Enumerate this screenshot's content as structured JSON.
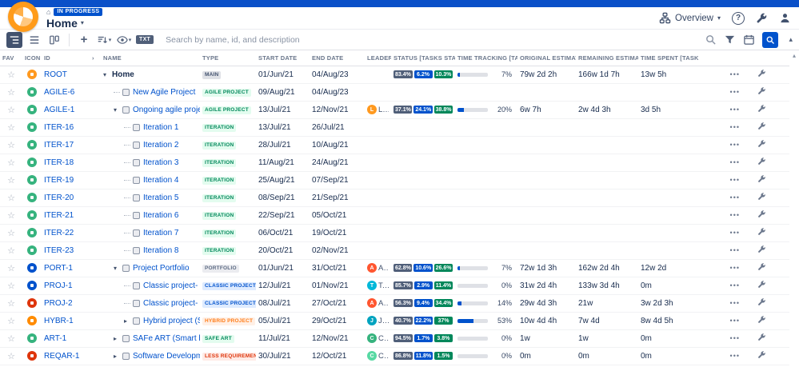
{
  "header": {
    "status_badge": "IN PROGRESS",
    "title": "Home",
    "overview_label": "Overview",
    "help_label": "?"
  },
  "toolbar": {
    "add_label": "+",
    "txt_label": "TXT",
    "search_placeholder": "Search by name, id, and description"
  },
  "icons": {
    "house": "⌂",
    "chevron_down": "▾",
    "chevron_right": "▸",
    "chevron_up": "▴",
    "star": "☆",
    "more": "•••"
  },
  "colors": {
    "accent": "#0052cc",
    "topstrip": "#0a50c8",
    "status_colors": [
      "#505f79",
      "#0052cc",
      "#00875a"
    ],
    "type_styles": {
      "main": {
        "bg": "#dfe1e6",
        "fg": "#42526e"
      },
      "agile": {
        "bg": "#e3fcef",
        "fg": "#00875a"
      },
      "iteration": {
        "bg": "#e3fcef",
        "fg": "#00875a"
      },
      "portfolio": {
        "bg": "#ebecf0",
        "fg": "#5e6c84"
      },
      "classic": {
        "bg": "#deebff",
        "fg": "#0052cc"
      },
      "hybrid": {
        "bg": "#fff0e6",
        "fg": "#ff7d1a"
      },
      "safe": {
        "bg": "#e3fcef",
        "fg": "#00875a"
      },
      "less": {
        "bg": "#ffebe6",
        "fg": "#de350b"
      }
    }
  },
  "table": {
    "columns": [
      {
        "key": "fav",
        "label": "FAV"
      },
      {
        "key": "icon",
        "label": "ICON"
      },
      {
        "key": "id",
        "label": "ID"
      },
      {
        "key": "chev",
        "label": "›"
      },
      {
        "key": "name",
        "label": "NAME"
      },
      {
        "key": "type",
        "label": "TYPE"
      },
      {
        "key": "start",
        "label": "START DATE"
      },
      {
        "key": "end",
        "label": "END DATE"
      },
      {
        "key": "leader",
        "label": "LEADER"
      },
      {
        "key": "status",
        "label": "STATUS [TASKS STATUS ("
      },
      {
        "key": "tracking",
        "label": "TIME TRACKING [TASKS S"
      },
      {
        "key": "original",
        "label": "ORIGINAL ESTIMATE ["
      },
      {
        "key": "remaining",
        "label": "REMAINING ESTIMATI"
      },
      {
        "key": "spent",
        "label": "TIME SPENT [TASKS S"
      },
      {
        "key": "actions",
        "label": ""
      }
    ],
    "rows": [
      {
        "id": "ROOT",
        "icon_color": "#ff991f",
        "level": 0,
        "expander": "down",
        "box": false,
        "name": "Home",
        "link": false,
        "type": "MAIN",
        "type_key": "main",
        "start": "01/Jun/21",
        "end": "04/Aug/23",
        "leader": null,
        "status": [
          "83.4%",
          "6.2%",
          "10.3%"
        ],
        "tracking": {
          "label": "7%",
          "fill": 7
        },
        "original": "79w 2d 2h",
        "remaining": "166w 1d 7h",
        "spent": "13w 5h"
      },
      {
        "id": "AGILE-6",
        "icon_color": "#36b37e",
        "level": 1,
        "expander": null,
        "box": true,
        "name": "New Agile Project",
        "link": true,
        "type": "AGILE PROJECT",
        "type_key": "agile",
        "start": "09/Aug/21",
        "end": "04/Aug/23",
        "leader": null,
        "status": null,
        "tracking": null,
        "original": "",
        "remaining": "",
        "spent": ""
      },
      {
        "id": "AGILE-1",
        "icon_color": "#36b37e",
        "level": 1,
        "expander": "down",
        "box": true,
        "name": "Ongoing agile project (E-commerc",
        "link": true,
        "type": "AGILE PROJECT",
        "type_key": "agile",
        "start": "13/Jul/21",
        "end": "12/Nov/21",
        "leader": {
          "name": "Lesly",
          "color": "#ff991f"
        },
        "status": [
          "37.1%",
          "24.1%",
          "38.8%"
        ],
        "tracking": {
          "label": "20%",
          "fill": 20
        },
        "original": "6w 7h",
        "remaining": "2w 4d 3h",
        "spent": "3d 5h"
      },
      {
        "id": "ITER-16",
        "icon_color": "#36b37e",
        "level": 2,
        "expander": null,
        "box": true,
        "name": "Iteration 1",
        "link": true,
        "type": "ITERATION",
        "type_key": "iteration",
        "start": "13/Jul/21",
        "end": "26/Jul/21",
        "leader": null,
        "status": null,
        "tracking": null,
        "original": "",
        "remaining": "",
        "spent": ""
      },
      {
        "id": "ITER-17",
        "icon_color": "#36b37e",
        "level": 2,
        "expander": null,
        "box": true,
        "name": "Iteration 2",
        "link": true,
        "type": "ITERATION",
        "type_key": "iteration",
        "start": "28/Jul/21",
        "end": "10/Aug/21",
        "leader": null,
        "status": null,
        "tracking": null,
        "original": "",
        "remaining": "",
        "spent": ""
      },
      {
        "id": "ITER-18",
        "icon_color": "#36b37e",
        "level": 2,
        "expander": null,
        "box": true,
        "name": "Iteration 3",
        "link": true,
        "type": "ITERATION",
        "type_key": "iteration",
        "start": "11/Aug/21",
        "end": "24/Aug/21",
        "leader": null,
        "status": null,
        "tracking": null,
        "original": "",
        "remaining": "",
        "spent": ""
      },
      {
        "id": "ITER-19",
        "icon_color": "#36b37e",
        "level": 2,
        "expander": null,
        "box": true,
        "name": "Iteration 4",
        "link": true,
        "type": "ITERATION",
        "type_key": "iteration",
        "start": "25/Aug/21",
        "end": "07/Sep/21",
        "leader": null,
        "status": null,
        "tracking": null,
        "original": "",
        "remaining": "",
        "spent": ""
      },
      {
        "id": "ITER-20",
        "icon_color": "#36b37e",
        "level": 2,
        "expander": null,
        "box": true,
        "name": "Iteration 5",
        "link": true,
        "type": "ITERATION",
        "type_key": "iteration",
        "start": "08/Sep/21",
        "end": "21/Sep/21",
        "leader": null,
        "status": null,
        "tracking": null,
        "original": "",
        "remaining": "",
        "spent": ""
      },
      {
        "id": "ITER-21",
        "icon_color": "#36b37e",
        "level": 2,
        "expander": null,
        "box": true,
        "name": "Iteration 6",
        "link": true,
        "type": "ITERATION",
        "type_key": "iteration",
        "start": "22/Sep/21",
        "end": "05/Oct/21",
        "leader": null,
        "status": null,
        "tracking": null,
        "original": "",
        "remaining": "",
        "spent": ""
      },
      {
        "id": "ITER-22",
        "icon_color": "#36b37e",
        "level": 2,
        "expander": null,
        "box": true,
        "name": "Iteration 7",
        "link": true,
        "type": "ITERATION",
        "type_key": "iteration",
        "start": "06/Oct/21",
        "end": "19/Oct/21",
        "leader": null,
        "status": null,
        "tracking": null,
        "original": "",
        "remaining": "",
        "spent": ""
      },
      {
        "id": "ITER-23",
        "icon_color": "#36b37e",
        "level": 2,
        "expander": null,
        "box": true,
        "name": "Iteration 8",
        "link": true,
        "type": "ITERATION",
        "type_key": "iteration",
        "start": "20/Oct/21",
        "end": "02/Nov/21",
        "leader": null,
        "status": null,
        "tracking": null,
        "original": "",
        "remaining": "",
        "spent": ""
      },
      {
        "id": "PORT-1",
        "icon_color": "#0052cc",
        "level": 1,
        "expander": "down",
        "box": true,
        "name": "Project Portfolio",
        "link": true,
        "type": "PORTFOLIO",
        "type_key": "portfolio",
        "start": "01/Jun/21",
        "end": "31/Oct/21",
        "leader": {
          "name": "Ange",
          "color": "#ff5630"
        },
        "status": [
          "62.8%",
          "10.6%",
          "26.6%"
        ],
        "tracking": {
          "label": "7%",
          "fill": 7
        },
        "original": "72w 1d 3h",
        "remaining": "162w 2d 4h",
        "spent": "12w 2d"
      },
      {
        "id": "PROJ-1",
        "icon_color": "#0052cc",
        "level": 2,
        "expander": null,
        "box": true,
        "name": "Classic project- initiation (Build",
        "link": true,
        "type": "CLASSIC PROJECT",
        "type_key": "classic",
        "start": "12/Jul/21",
        "end": "01/Nov/21",
        "leader": {
          "name": "Tash",
          "color": "#00b8d9"
        },
        "status": [
          "85.7%",
          "2.9%",
          "11.4%"
        ],
        "tracking": {
          "label": "0%",
          "fill": 0
        },
        "original": "31w 2d 4h",
        "remaining": "133w 3d 4h",
        "spent": "0m"
      },
      {
        "id": "PROJ-2",
        "icon_color": "#de350b",
        "level": 2,
        "expander": null,
        "box": true,
        "name": "Classic project- progress monit",
        "link": true,
        "type": "CLASSIC PROJECT",
        "type_key": "classic",
        "start": "08/Jul/21",
        "end": "27/Oct/21",
        "leader": {
          "name": "Ange",
          "color": "#ff5630"
        },
        "status": [
          "56.3%",
          "9.4%",
          "34.4%"
        ],
        "tracking": {
          "label": "14%",
          "fill": 14
        },
        "original": "29w 4d 3h",
        "remaining": "21w",
        "spent": "3w 2d 3h"
      },
      {
        "id": "HYBR-1",
        "icon_color": "#ff8b00",
        "level": 2,
        "expander": "right",
        "box": true,
        "name": "Hybrid project (Sport App)",
        "link": true,
        "type": "HYBRID PROJECT",
        "type_key": "hybrid",
        "start": "05/Jul/21",
        "end": "29/Oct/21",
        "leader": {
          "name": "Jero",
          "color": "#00a3bf"
        },
        "status": [
          "40.7%",
          "22.2%",
          "37%"
        ],
        "tracking": {
          "label": "53%",
          "fill": 53
        },
        "original": "10w 4d 4h",
        "remaining": "7w 4d",
        "spent": "8w 4d 5h"
      },
      {
        "id": "ART-1",
        "icon_color": "#36b37e",
        "level": 1,
        "expander": "right",
        "box": true,
        "name": "SAFe ART (Smart house)",
        "link": true,
        "type": "SAFE ART",
        "type_key": "safe",
        "start": "11/Jul/21",
        "end": "12/Nov/21",
        "leader": {
          "name": "Chris",
          "color": "#36b37e"
        },
        "status": [
          "94.5%",
          "1.7%",
          "3.8%"
        ],
        "tracking": {
          "label": "0%",
          "fill": 0
        },
        "original": "1w",
        "remaining": "1w",
        "spent": "0m"
      },
      {
        "id": "REQAR-1",
        "icon_color": "#de350b",
        "level": 1,
        "expander": "right",
        "box": true,
        "name": "Software Development - LeSS",
        "link": true,
        "type": "LESS REQUIREMENT AI",
        "type_key": "less",
        "start": "30/Jul/21",
        "end": "12/Oct/21",
        "leader": {
          "name": "Calvi",
          "color": "#57d9a3"
        },
        "status": [
          "86.8%",
          "11.8%",
          "1.5%"
        ],
        "tracking": {
          "label": "0%",
          "fill": 0
        },
        "original": "0m",
        "remaining": "0m",
        "spent": "0m"
      }
    ]
  }
}
